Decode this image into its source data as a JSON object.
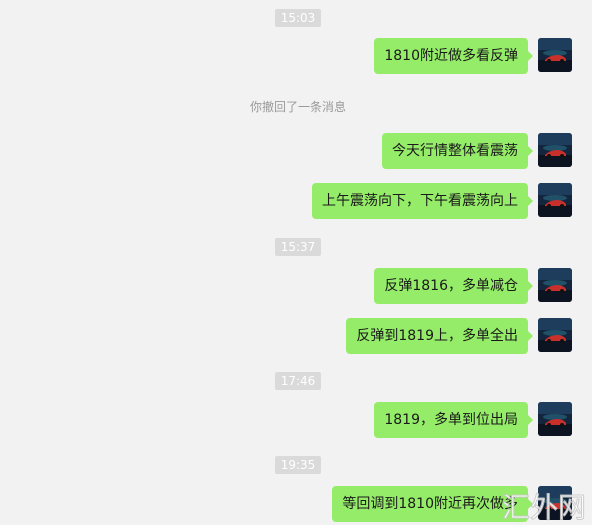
{
  "timestamps": [
    "15:03",
    "15:37",
    "17:46",
    "19:35"
  ],
  "system_notice": "你撤回了一条消息",
  "messages": [
    {
      "text": "1810附近做多看反弹"
    },
    {
      "text": "今天行情整体看震荡"
    },
    {
      "text": "上午震荡向下，下午看震荡向上"
    },
    {
      "text": "反弹1816，多单减仓"
    },
    {
      "text": "反弹到1819上，多单全出"
    },
    {
      "text": "1819，多单到位出局"
    },
    {
      "text": "等回调到1810附近再次做多"
    }
  ],
  "watermark_text": "汇外网",
  "colors": {
    "background": "#f2f2f2",
    "bubble": "#95ec69",
    "timestamp_bg": "#dadada"
  }
}
